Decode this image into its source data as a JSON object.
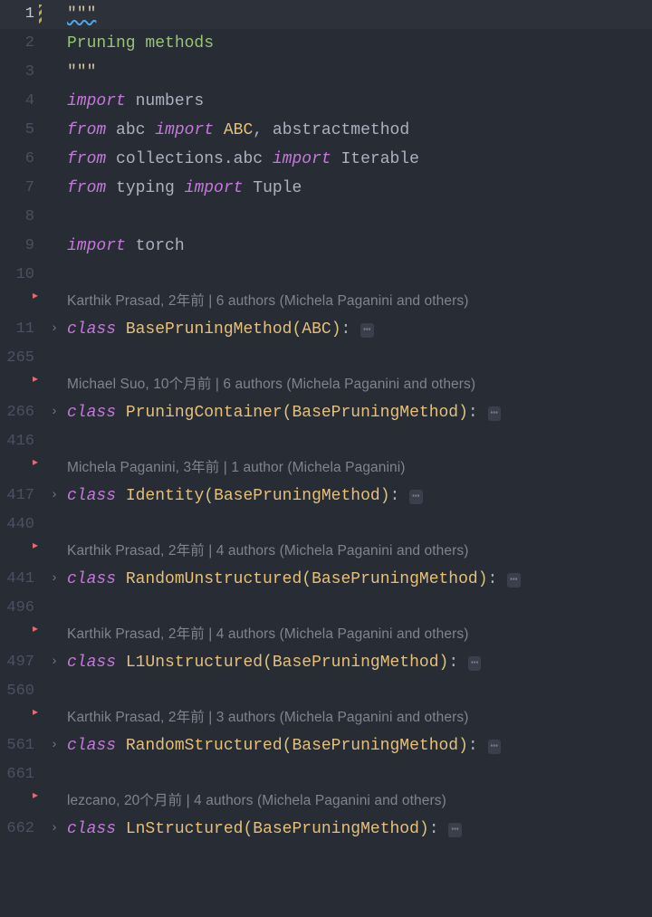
{
  "lines": {
    "l1": {
      "num": "1",
      "quote": "\"\"\""
    },
    "l2": {
      "num": "2",
      "text": "Pruning methods"
    },
    "l3": {
      "num": "3",
      "quote": "\"\"\""
    },
    "l4": {
      "num": "4",
      "kw1": "import",
      "mod": "numbers"
    },
    "l5": {
      "num": "5",
      "kw1": "from",
      "mod": "abc",
      "kw2": "import",
      "n1": "ABC",
      "comma": ", ",
      "n2": "abstractmethod"
    },
    "l6": {
      "num": "6",
      "kw1": "from",
      "mod": "collections.abc",
      "kw2": "import",
      "n1": "Iterable"
    },
    "l7": {
      "num": "7",
      "kw1": "from",
      "mod": "typing",
      "kw2": "import",
      "n1": "Tuple"
    },
    "l8": {
      "num": "8"
    },
    "l9": {
      "num": "9",
      "kw1": "import",
      "mod": "torch"
    },
    "l10": {
      "num": "10"
    },
    "l265": {
      "num": "265"
    },
    "l416": {
      "num": "416"
    },
    "l440": {
      "num": "440"
    },
    "l496": {
      "num": "496"
    },
    "l560": {
      "num": "560"
    },
    "l661": {
      "num": "661"
    }
  },
  "classes": {
    "c11": {
      "num": "11",
      "fold": "›",
      "kw": "class",
      "name": "BasePruningMethod",
      "base": "ABC",
      "colon": ":",
      "ell": "⋯"
    },
    "c266": {
      "num": "266",
      "fold": "›",
      "kw": "class",
      "name": "PruningContainer",
      "base": "BasePruningMethod",
      "colon": ":",
      "ell": "⋯"
    },
    "c417": {
      "num": "417",
      "fold": "›",
      "kw": "class",
      "name": "Identity",
      "base": "BasePruningMethod",
      "colon": ":",
      "ell": "⋯"
    },
    "c441": {
      "num": "441",
      "fold": "›",
      "kw": "class",
      "name": "RandomUnstructured",
      "base": "BasePruningMethod",
      "colon": ":",
      "ell": "⋯"
    },
    "c497": {
      "num": "497",
      "fold": "›",
      "kw": "class",
      "name": "L1Unstructured",
      "base": "BasePruningMethod",
      "colon": ":",
      "ell": "⋯"
    },
    "c561": {
      "num": "561",
      "fold": "›",
      "kw": "class",
      "name": "RandomStructured",
      "base": "BasePruningMethod",
      "colon": ":",
      "ell": "⋯"
    },
    "c662": {
      "num": "662",
      "fold": "›",
      "kw": "class",
      "name": "LnStructured",
      "base": "BasePruningMethod",
      "colon": ":",
      "ell": "⋯"
    }
  },
  "codelens": {
    "cl11": "Karthik Prasad, 2年前 | 6 authors (Michela Paganini and others)",
    "cl266": "Michael Suo, 10个月前 | 6 authors (Michela Paganini and others)",
    "cl417": "Michela Paganini, 3年前 | 1 author (Michela Paganini)",
    "cl441": "Karthik Prasad, 2年前 | 4 authors (Michela Paganini and others)",
    "cl497": "Karthik Prasad, 2年前 | 4 authors (Michela Paganini and others)",
    "cl561": "Karthik Prasad, 2年前 | 3 authors (Michela Paganini and others)",
    "cl662": "lezcano, 20个月前 | 4 authors (Michela Paganini and others)"
  },
  "fold_marker": "▸",
  "paren_open": "(",
  "paren_close": ")"
}
